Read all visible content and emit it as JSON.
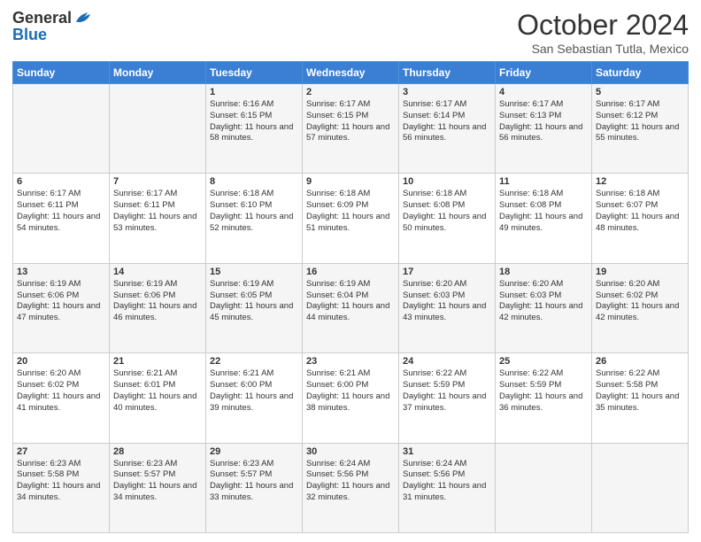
{
  "header": {
    "logo_general": "General",
    "logo_blue": "Blue",
    "month": "October 2024",
    "location": "San Sebastian Tutla, Mexico"
  },
  "days_of_week": [
    "Sunday",
    "Monday",
    "Tuesday",
    "Wednesday",
    "Thursday",
    "Friday",
    "Saturday"
  ],
  "weeks": [
    [
      {
        "day": "",
        "sunrise": "",
        "sunset": "",
        "daylight": ""
      },
      {
        "day": "",
        "sunrise": "",
        "sunset": "",
        "daylight": ""
      },
      {
        "day": "1",
        "sunrise": "Sunrise: 6:16 AM",
        "sunset": "Sunset: 6:15 PM",
        "daylight": "Daylight: 11 hours and 58 minutes."
      },
      {
        "day": "2",
        "sunrise": "Sunrise: 6:17 AM",
        "sunset": "Sunset: 6:15 PM",
        "daylight": "Daylight: 11 hours and 57 minutes."
      },
      {
        "day": "3",
        "sunrise": "Sunrise: 6:17 AM",
        "sunset": "Sunset: 6:14 PM",
        "daylight": "Daylight: 11 hours and 56 minutes."
      },
      {
        "day": "4",
        "sunrise": "Sunrise: 6:17 AM",
        "sunset": "Sunset: 6:13 PM",
        "daylight": "Daylight: 11 hours and 56 minutes."
      },
      {
        "day": "5",
        "sunrise": "Sunrise: 6:17 AM",
        "sunset": "Sunset: 6:12 PM",
        "daylight": "Daylight: 11 hours and 55 minutes."
      }
    ],
    [
      {
        "day": "6",
        "sunrise": "Sunrise: 6:17 AM",
        "sunset": "Sunset: 6:11 PM",
        "daylight": "Daylight: 11 hours and 54 minutes."
      },
      {
        "day": "7",
        "sunrise": "Sunrise: 6:17 AM",
        "sunset": "Sunset: 6:11 PM",
        "daylight": "Daylight: 11 hours and 53 minutes."
      },
      {
        "day": "8",
        "sunrise": "Sunrise: 6:18 AM",
        "sunset": "Sunset: 6:10 PM",
        "daylight": "Daylight: 11 hours and 52 minutes."
      },
      {
        "day": "9",
        "sunrise": "Sunrise: 6:18 AM",
        "sunset": "Sunset: 6:09 PM",
        "daylight": "Daylight: 11 hours and 51 minutes."
      },
      {
        "day": "10",
        "sunrise": "Sunrise: 6:18 AM",
        "sunset": "Sunset: 6:08 PM",
        "daylight": "Daylight: 11 hours and 50 minutes."
      },
      {
        "day": "11",
        "sunrise": "Sunrise: 6:18 AM",
        "sunset": "Sunset: 6:08 PM",
        "daylight": "Daylight: 11 hours and 49 minutes."
      },
      {
        "day": "12",
        "sunrise": "Sunrise: 6:18 AM",
        "sunset": "Sunset: 6:07 PM",
        "daylight": "Daylight: 11 hours and 48 minutes."
      }
    ],
    [
      {
        "day": "13",
        "sunrise": "Sunrise: 6:19 AM",
        "sunset": "Sunset: 6:06 PM",
        "daylight": "Daylight: 11 hours and 47 minutes."
      },
      {
        "day": "14",
        "sunrise": "Sunrise: 6:19 AM",
        "sunset": "Sunset: 6:06 PM",
        "daylight": "Daylight: 11 hours and 46 minutes."
      },
      {
        "day": "15",
        "sunrise": "Sunrise: 6:19 AM",
        "sunset": "Sunset: 6:05 PM",
        "daylight": "Daylight: 11 hours and 45 minutes."
      },
      {
        "day": "16",
        "sunrise": "Sunrise: 6:19 AM",
        "sunset": "Sunset: 6:04 PM",
        "daylight": "Daylight: 11 hours and 44 minutes."
      },
      {
        "day": "17",
        "sunrise": "Sunrise: 6:20 AM",
        "sunset": "Sunset: 6:03 PM",
        "daylight": "Daylight: 11 hours and 43 minutes."
      },
      {
        "day": "18",
        "sunrise": "Sunrise: 6:20 AM",
        "sunset": "Sunset: 6:03 PM",
        "daylight": "Daylight: 11 hours and 42 minutes."
      },
      {
        "day": "19",
        "sunrise": "Sunrise: 6:20 AM",
        "sunset": "Sunset: 6:02 PM",
        "daylight": "Daylight: 11 hours and 42 minutes."
      }
    ],
    [
      {
        "day": "20",
        "sunrise": "Sunrise: 6:20 AM",
        "sunset": "Sunset: 6:02 PM",
        "daylight": "Daylight: 11 hours and 41 minutes."
      },
      {
        "day": "21",
        "sunrise": "Sunrise: 6:21 AM",
        "sunset": "Sunset: 6:01 PM",
        "daylight": "Daylight: 11 hours and 40 minutes."
      },
      {
        "day": "22",
        "sunrise": "Sunrise: 6:21 AM",
        "sunset": "Sunset: 6:00 PM",
        "daylight": "Daylight: 11 hours and 39 minutes."
      },
      {
        "day": "23",
        "sunrise": "Sunrise: 6:21 AM",
        "sunset": "Sunset: 6:00 PM",
        "daylight": "Daylight: 11 hours and 38 minutes."
      },
      {
        "day": "24",
        "sunrise": "Sunrise: 6:22 AM",
        "sunset": "Sunset: 5:59 PM",
        "daylight": "Daylight: 11 hours and 37 minutes."
      },
      {
        "day": "25",
        "sunrise": "Sunrise: 6:22 AM",
        "sunset": "Sunset: 5:59 PM",
        "daylight": "Daylight: 11 hours and 36 minutes."
      },
      {
        "day": "26",
        "sunrise": "Sunrise: 6:22 AM",
        "sunset": "Sunset: 5:58 PM",
        "daylight": "Daylight: 11 hours and 35 minutes."
      }
    ],
    [
      {
        "day": "27",
        "sunrise": "Sunrise: 6:23 AM",
        "sunset": "Sunset: 5:58 PM",
        "daylight": "Daylight: 11 hours and 34 minutes."
      },
      {
        "day": "28",
        "sunrise": "Sunrise: 6:23 AM",
        "sunset": "Sunset: 5:57 PM",
        "daylight": "Daylight: 11 hours and 34 minutes."
      },
      {
        "day": "29",
        "sunrise": "Sunrise: 6:23 AM",
        "sunset": "Sunset: 5:57 PM",
        "daylight": "Daylight: 11 hours and 33 minutes."
      },
      {
        "day": "30",
        "sunrise": "Sunrise: 6:24 AM",
        "sunset": "Sunset: 5:56 PM",
        "daylight": "Daylight: 11 hours and 32 minutes."
      },
      {
        "day": "31",
        "sunrise": "Sunrise: 6:24 AM",
        "sunset": "Sunset: 5:56 PM",
        "daylight": "Daylight: 11 hours and 31 minutes."
      },
      {
        "day": "",
        "sunrise": "",
        "sunset": "",
        "daylight": ""
      },
      {
        "day": "",
        "sunrise": "",
        "sunset": "",
        "daylight": ""
      }
    ]
  ]
}
